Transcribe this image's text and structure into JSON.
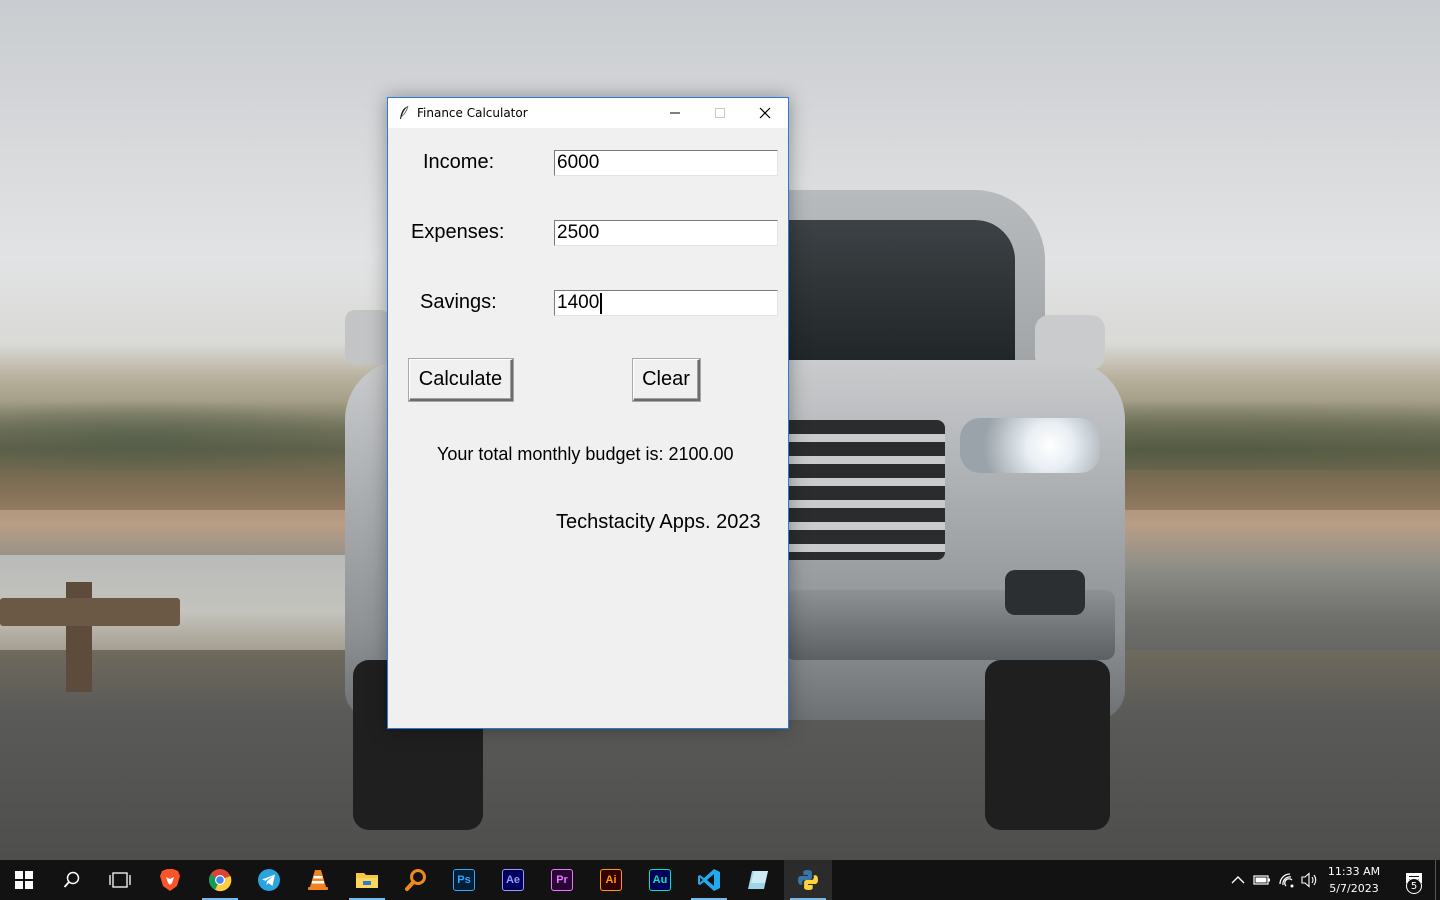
{
  "window": {
    "title": "Finance Calculator"
  },
  "form": {
    "income_label": "Income:",
    "income_value": "6000",
    "expenses_label": "Expenses:",
    "expenses_value": "2500",
    "savings_label": "Savings:",
    "savings_value": "1400"
  },
  "buttons": {
    "calculate": "Calculate",
    "clear": "Clear"
  },
  "result_text": "Your total monthly budget is: 2100.00",
  "footer_text": "Techstacity Apps. 2023",
  "taskbar": {
    "apps": [
      {
        "name": "brave",
        "icon": "brave-lion-icon",
        "color": "#fb542b"
      },
      {
        "name": "chrome",
        "icon": "chrome-icon",
        "color": "#4285f4",
        "active_underline": true
      },
      {
        "name": "telegram",
        "icon": "telegram-icon",
        "color": "#2aa3df"
      },
      {
        "name": "vlc",
        "icon": "vlc-cone-icon",
        "color": "#f58220"
      },
      {
        "name": "file-explorer",
        "icon": "folder-icon",
        "color": "#f7c844",
        "active_underline": true
      },
      {
        "name": "search-tool",
        "icon": "magnifier-icon",
        "color": "#f08a1c"
      },
      {
        "name": "photoshop",
        "label": "Ps",
        "color": "#31a8ff",
        "bg": "#001e36"
      },
      {
        "name": "after-effects",
        "label": "Ae",
        "color": "#9999ff",
        "bg": "#00005b"
      },
      {
        "name": "premiere",
        "label": "Pr",
        "color": "#ea77ff",
        "bg": "#2a0634"
      },
      {
        "name": "illustrator",
        "label": "Ai",
        "color": "#ff9a00",
        "bg": "#330000"
      },
      {
        "name": "audition",
        "label": "Au",
        "color": "#00e4bb",
        "bg": "#00005b"
      },
      {
        "name": "vscode",
        "icon": "vscode-icon",
        "color": "#23a8f2",
        "active_underline": true
      },
      {
        "name": "notepad",
        "icon": "notepad-icon",
        "color": "#9fd3e8"
      },
      {
        "name": "python",
        "icon": "python-icon",
        "color": "#3776ab",
        "active": true
      }
    ],
    "clock_time": "11:33 AM",
    "clock_date": "5/7/2023",
    "notification_count": "5"
  }
}
